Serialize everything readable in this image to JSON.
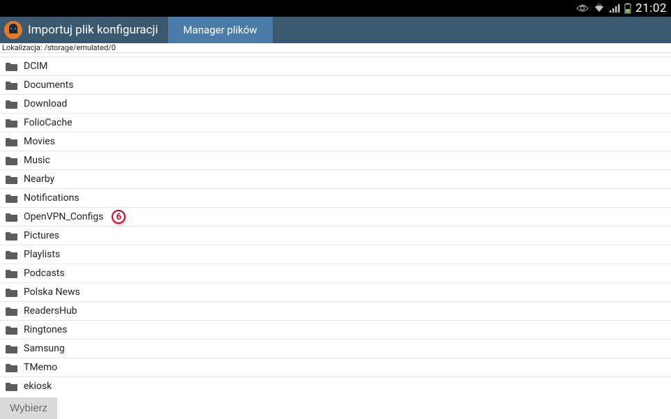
{
  "status": {
    "time": "21:02"
  },
  "appbar": {
    "title": "Importuj plik konfiguracji",
    "tab_label": "Manager plików"
  },
  "location": {
    "prefix": "Lokalizacja: ",
    "path": "/storage/emulated/0"
  },
  "folders": [
    {
      "name": "…"
    },
    {
      "name": "DCIM"
    },
    {
      "name": "Documents"
    },
    {
      "name": "Download"
    },
    {
      "name": "FolioCache"
    },
    {
      "name": "Movies"
    },
    {
      "name": "Music"
    },
    {
      "name": "Nearby"
    },
    {
      "name": "Notifications"
    },
    {
      "name": "OpenVPN_Configs",
      "annotation": "6"
    },
    {
      "name": "Pictures"
    },
    {
      "name": "Playlists"
    },
    {
      "name": "Podcasts"
    },
    {
      "name": "Polska News"
    },
    {
      "name": "ReadersHub"
    },
    {
      "name": "Ringtones"
    },
    {
      "name": "Samsung"
    },
    {
      "name": "TMemo"
    },
    {
      "name": "ekiosk"
    }
  ],
  "bottom": {
    "choose_label": "Wybierz"
  }
}
